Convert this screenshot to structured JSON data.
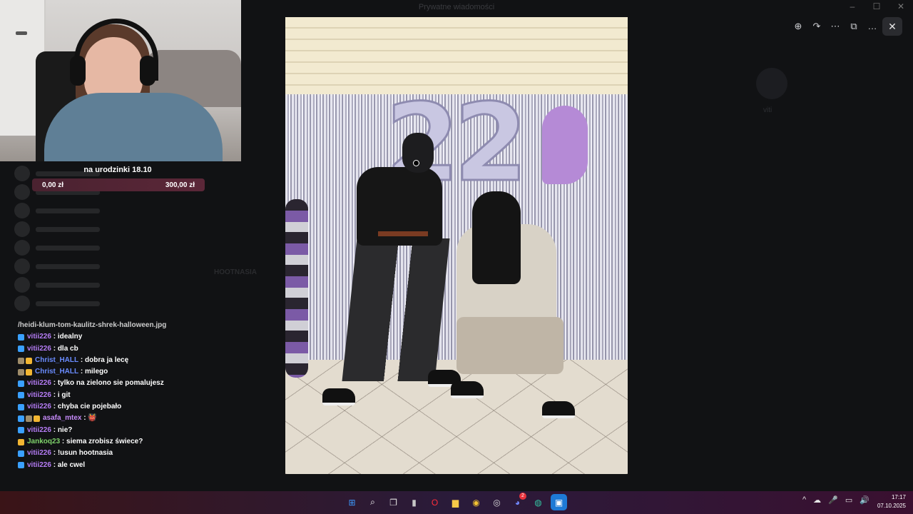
{
  "background_window": {
    "title": "Prywatne wiadomości",
    "right_panel_name": "viti",
    "mid_text": "HOOTNASIA"
  },
  "donation_goal": {
    "title": "na urodzinki 18.10",
    "current": "0,00 zł",
    "target": "300,00 zł",
    "progress_fraction": 0
  },
  "chat": {
    "clipped_line": "/heidi-klum-tom-kaulitz-shrek-halloween.jpg",
    "messages": [
      {
        "user": "vitii226",
        "text": "idealny",
        "color": "#b57cf5",
        "badges": [
          "#3aa0ff"
        ]
      },
      {
        "user": "vitii226",
        "text": "dla cb",
        "color": "#b57cf5",
        "badges": [
          "#3aa0ff"
        ]
      },
      {
        "user": "Christ_HALL",
        "text": "dobra ja lecę",
        "color": "#6a8cff",
        "badges": [
          "#9e8c6a",
          "#f2b632"
        ]
      },
      {
        "user": "Christ_HALL",
        "text": "milego",
        "color": "#6a8cff",
        "badges": [
          "#9e8c6a",
          "#f2b632"
        ]
      },
      {
        "user": "vitii226",
        "text": "tylko na zielono sie pomalujesz",
        "color": "#b57cf5",
        "badges": [
          "#3aa0ff"
        ]
      },
      {
        "user": "vitii226",
        "text": "i git",
        "color": "#b57cf5",
        "badges": [
          "#3aa0ff"
        ]
      },
      {
        "user": "vitii226",
        "text": "chyba cie pojebało",
        "color": "#b57cf5",
        "badges": [
          "#3aa0ff"
        ]
      },
      {
        "user": "asafa_mtex",
        "text": "👹",
        "color": "#c58af9",
        "badges": [
          "#3aa0ff",
          "#9e8c6a",
          "#f2b632"
        ]
      },
      {
        "user": "vitii226",
        "text": "nie?",
        "color": "#b57cf5",
        "badges": [
          "#3aa0ff"
        ]
      },
      {
        "user": "Jankoq23",
        "text": "siema zrobisz świece?",
        "color": "#7fd36b",
        "badges": [
          "#f2b632"
        ]
      },
      {
        "user": "vitii226",
        "text": "!usun hootnasia",
        "color": "#b57cf5",
        "badges": [
          "#3aa0ff"
        ]
      },
      {
        "user": "vitii226",
        "text": "ale cwel",
        "color": "#b57cf5",
        "badges": [
          "#3aa0ff"
        ]
      }
    ]
  },
  "photo": {
    "balloon_digits": [
      "2",
      "2"
    ]
  },
  "viewer_toolbar": {
    "icons": [
      "zoom-in-icon",
      "rotate-icon",
      "more-dots-icon",
      "open-external-icon",
      "ellipsis-icon"
    ],
    "close_label": "✕"
  },
  "taskbar": {
    "apps": [
      {
        "name": "windows-start",
        "glyph": "⊞",
        "bg": "transparent",
        "color": "#3d9bff"
      },
      {
        "name": "search",
        "glyph": "⌕",
        "bg": "transparent",
        "color": "#ffffff"
      },
      {
        "name": "task-view",
        "glyph": "❐",
        "bg": "transparent",
        "color": "#e0e0e0"
      },
      {
        "name": "obs",
        "glyph": "▮",
        "bg": "transparent",
        "color": "#c7c7c7"
      },
      {
        "name": "opera",
        "glyph": "O",
        "bg": "transparent",
        "color": "#ff2d3b"
      },
      {
        "name": "file-explorer",
        "glyph": "▆",
        "bg": "transparent",
        "color": "#f7c948"
      },
      {
        "name": "chrome",
        "glyph": "◉",
        "bg": "transparent",
        "color": "#f2c232"
      },
      {
        "name": "obs-studio",
        "glyph": "◎",
        "bg": "transparent",
        "color": "#dcdcdc",
        "badge": ""
      },
      {
        "name": "discord",
        "glyph": "◕",
        "bg": "transparent",
        "color": "#7289ff",
        "badge": "2"
      },
      {
        "name": "browser-globe",
        "glyph": "◍",
        "bg": "transparent",
        "color": "#33c2a0"
      },
      {
        "name": "photos",
        "glyph": "▣",
        "bg": "#1e7ad6",
        "color": "#fff"
      }
    ],
    "tray": [
      "^",
      "☁",
      "🎤",
      "▭",
      "🔊"
    ],
    "time": "17:17",
    "date": "07.10.2025"
  }
}
